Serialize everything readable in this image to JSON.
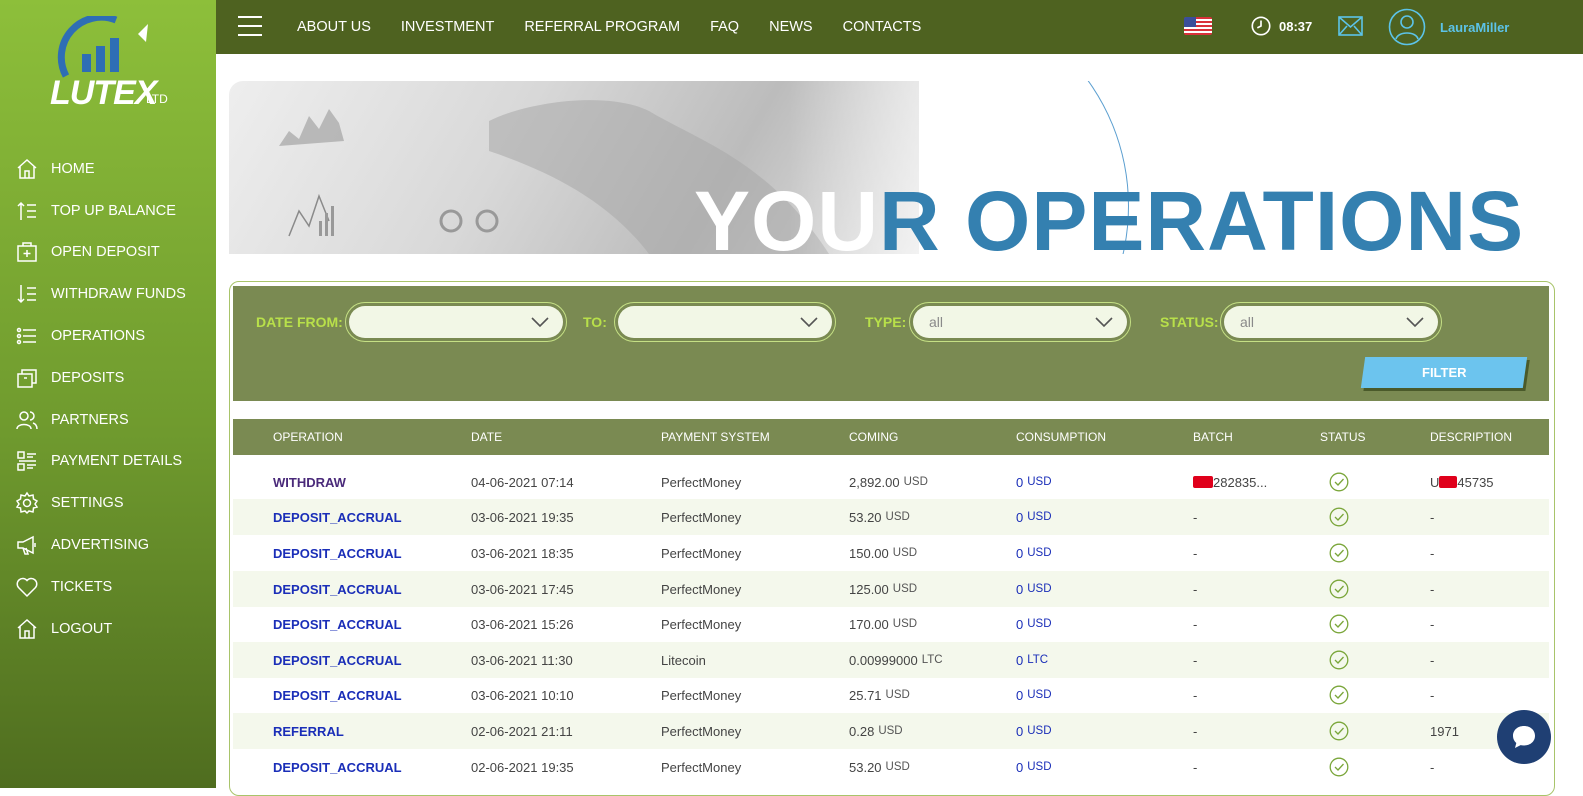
{
  "brand": {
    "logo_text": "LUTEX",
    "logo_suffix": "LTD"
  },
  "sidebar": {
    "items": [
      {
        "label": "HOME",
        "icon": "home-icon"
      },
      {
        "label": "TOP UP BALANCE",
        "icon": "top-up-icon"
      },
      {
        "label": "OPEN DEPOSIT",
        "icon": "open-deposit-icon"
      },
      {
        "label": "WITHDRAW FUNDS",
        "icon": "withdraw-icon"
      },
      {
        "label": "OPERATIONS",
        "icon": "list-icon"
      },
      {
        "label": "DEPOSITS",
        "icon": "deposits-icon"
      },
      {
        "label": "PARTNERS",
        "icon": "partners-icon"
      },
      {
        "label": "PAYMENT DETAILS",
        "icon": "payment-details-icon"
      },
      {
        "label": "SETTINGS",
        "icon": "gear-icon"
      },
      {
        "label": "ADVERTISING",
        "icon": "megaphone-icon"
      },
      {
        "label": "TICKETS",
        "icon": "heart-icon"
      },
      {
        "label": "LOGOUT",
        "icon": "home-icon"
      }
    ]
  },
  "topnav": {
    "items": [
      "ABOUT US",
      "INVESTMENT",
      "REFERRAL PROGRAM",
      "FAQ",
      "NEWS",
      "CONTACTS"
    ],
    "time": "08:37",
    "username": "LauraMiller",
    "flag": "us-flag-icon"
  },
  "banner": {
    "title_light": "YOU",
    "title_dark": "R OPERATIONS"
  },
  "filters": {
    "date_from_label": "DATE FROM:",
    "to_label": "TO:",
    "type_label": "TYPE:",
    "type_value": "all",
    "status_label": "STATUS:",
    "status_value": "all",
    "button": "FILTER"
  },
  "table": {
    "headers": [
      "OPERATION",
      "DATE",
      "PAYMENT SYSTEM",
      "COMING",
      "CONSUMPTION",
      "BATCH",
      "STATUS",
      "DESCRIPTION"
    ],
    "rows": [
      {
        "operation": "WITHDRAW",
        "date": "04-06-2021 07:14",
        "system": "PerfectMoney",
        "coming": "2,892.00",
        "coming_cur": "USD",
        "cons": "0",
        "cons_cur": "USD",
        "batch": "282835...",
        "description": "45735",
        "description_prefix": "U"
      },
      {
        "operation": "DEPOSIT_ACCRUAL",
        "date": "03-06-2021 19:35",
        "system": "PerfectMoney",
        "coming": "53.20",
        "coming_cur": "USD",
        "cons": "0",
        "cons_cur": "USD",
        "batch": "-",
        "description": "-"
      },
      {
        "operation": "DEPOSIT_ACCRUAL",
        "date": "03-06-2021 18:35",
        "system": "PerfectMoney",
        "coming": "150.00",
        "coming_cur": "USD",
        "cons": "0",
        "cons_cur": "USD",
        "batch": "-",
        "description": "-"
      },
      {
        "operation": "DEPOSIT_ACCRUAL",
        "date": "03-06-2021 17:45",
        "system": "PerfectMoney",
        "coming": "125.00",
        "coming_cur": "USD",
        "cons": "0",
        "cons_cur": "USD",
        "batch": "-",
        "description": "-"
      },
      {
        "operation": "DEPOSIT_ACCRUAL",
        "date": "03-06-2021 15:26",
        "system": "PerfectMoney",
        "coming": "170.00",
        "coming_cur": "USD",
        "cons": "0",
        "cons_cur": "USD",
        "batch": "-",
        "description": "-"
      },
      {
        "operation": "DEPOSIT_ACCRUAL",
        "date": "03-06-2021 11:30",
        "system": "Litecoin",
        "coming": "0.00999000",
        "coming_cur": "LTC",
        "cons": "0",
        "cons_cur": "LTC",
        "batch": "-",
        "description": "-"
      },
      {
        "operation": "DEPOSIT_ACCRUAL",
        "date": "03-06-2021 10:10",
        "system": "PerfectMoney",
        "coming": "25.71",
        "coming_cur": "USD",
        "cons": "0",
        "cons_cur": "USD",
        "batch": "-",
        "description": "-"
      },
      {
        "operation": "REFERRAL",
        "date": "02-06-2021 21:11",
        "system": "PerfectMoney",
        "coming": "0.28",
        "coming_cur": "USD",
        "cons": "0",
        "cons_cur": "USD",
        "batch": "-",
        "description": "1971"
      },
      {
        "operation": "DEPOSIT_ACCRUAL",
        "date": "02-06-2021 19:35",
        "system": "PerfectMoney",
        "coming": "53.20",
        "coming_cur": "USD",
        "cons": "0",
        "cons_cur": "USD",
        "batch": "-",
        "description": "-"
      }
    ]
  },
  "colors": {
    "sidebar_top": "#8dbf3a",
    "topbar": "#4e6220",
    "filterbar": "#7a8a52",
    "accent_blue": "#6cc4ee",
    "link_blue": "#1a2eb8"
  }
}
